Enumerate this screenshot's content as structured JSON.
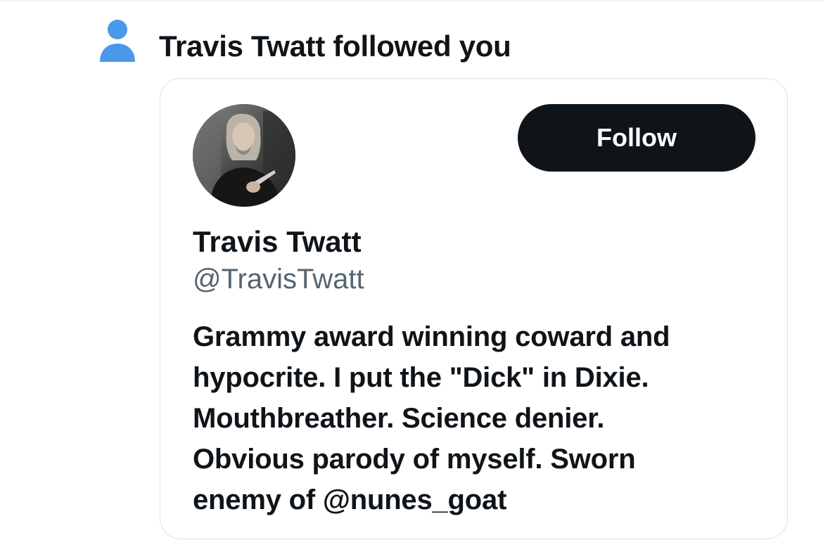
{
  "notification": {
    "icon": "person-icon",
    "icon_color": "#4a99e9",
    "actor_name": "Travis Twatt",
    "action_text": " followed you"
  },
  "profile_card": {
    "avatar": "profile-photo",
    "follow_button_label": "Follow",
    "display_name": "Travis Twatt",
    "handle": "@TravisTwatt",
    "bio": "Grammy award winning coward and\nhypocrite. I put the \"Dick\" in Dixie.\nMouthbreather. Science denier.\nObvious parody of myself. Sworn\nenemy of @nunes_goat"
  },
  "colors": {
    "text_primary": "#0f1419",
    "text_secondary": "#536471",
    "button_bg": "#0f1419",
    "button_text": "#ffffff",
    "card_border": "#dde3e7"
  }
}
